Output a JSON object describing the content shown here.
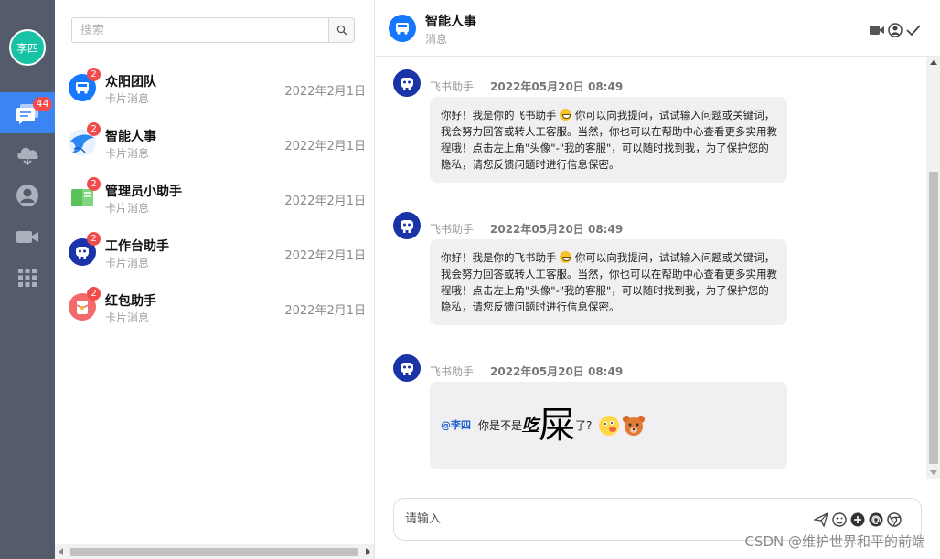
{
  "user": {
    "name": "李四"
  },
  "rail": {
    "unread_count": "44",
    "items": [
      {
        "name": "messages",
        "active": true
      },
      {
        "name": "cloud-download"
      },
      {
        "name": "contacts"
      },
      {
        "name": "video"
      },
      {
        "name": "apps"
      }
    ]
  },
  "search": {
    "placeholder": "搜索"
  },
  "conversations": [
    {
      "name": "众阳团队",
      "subtitle": "卡片消息",
      "date": "2022年2月1日",
      "badge": "2",
      "icon": "bus-icon",
      "color": "#1677ff"
    },
    {
      "name": "智能人事",
      "subtitle": "卡片消息",
      "date": "2022年2月1日",
      "badge": "2",
      "icon": "bird-icon",
      "color": "#2a86f0"
    },
    {
      "name": "管理员小助手",
      "subtitle": "卡片消息",
      "date": "2022年2月1日",
      "badge": "2",
      "icon": "book-icon",
      "color": "#57c35a"
    },
    {
      "name": "工作台助手",
      "subtitle": "卡片消息",
      "date": "2022年2月1日",
      "badge": "2",
      "icon": "robot-icon",
      "color": "#1a33a8"
    },
    {
      "name": "红包助手",
      "subtitle": "卡片消息",
      "date": "2022年2月1日",
      "badge": "2",
      "icon": "red-envelope-icon",
      "color": "#f26a6a"
    }
  ],
  "chat": {
    "title": "智能人事",
    "subtitle": "消息",
    "messages": [
      {
        "sender": "飞书助手",
        "time": "2022年05月20日 08:49",
        "text_before": "你好！我是你的飞书助手",
        "text_after": "你可以向我提问，试试输入问题或关键词，我会努力回答或转人工客服。当然，你也可以在帮助中心查看更多实用教程哦！点击左上角\"头像\"-\"我的客服\"，可以随时找到我，为了保护您的隐私，请您反馈问题时进行信息保密。"
      },
      {
        "sender": "飞书助手",
        "time": "2022年05月20日 08:49",
        "text_before": "你好！我是你的飞书助手",
        "text_after": "你可以向我提问，试试输入问题或关键词，我会努力回答或转人工客服。当然，你也可以在帮助中心查看更多实用教程哦！点击左上角\"头像\"-\"我的客服\"，可以随时找到我，为了保护您的隐私，请您反馈问题时进行信息保密。"
      },
      {
        "sender": "飞书助手",
        "time": "2022年05月20日 08:49",
        "mention": "@李四",
        "part1": "你是不是",
        "part2": "吃",
        "part3": "屎",
        "part4": "了?"
      }
    ]
  },
  "composer": {
    "placeholder": "请输入"
  },
  "watermark": "CSDN @维护世界和平的前端"
}
